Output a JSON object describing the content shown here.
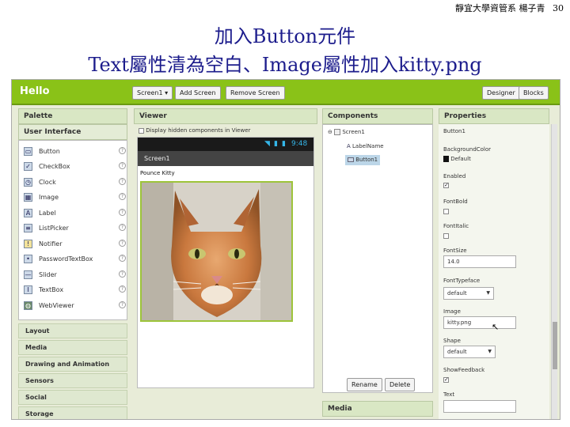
{
  "slide": {
    "header": "靜宜大學資管系 楊子青",
    "page_number": "30",
    "title_line1": "加入Button元件",
    "title_line2": "Text屬性清為空白、Image屬性加入kitty.png"
  },
  "app": {
    "name": "Hello",
    "screen_dropdown": "Screen1 ▾",
    "add_screen": "Add Screen",
    "remove_screen": "Remove Screen",
    "designer": "Designer",
    "blocks": "Blocks"
  },
  "palette": {
    "title": "Palette",
    "section": "User Interface",
    "items": [
      {
        "label": "Button",
        "icon": "▭"
      },
      {
        "label": "CheckBox",
        "icon": "✓"
      },
      {
        "label": "Clock",
        "icon": "◷"
      },
      {
        "label": "Image",
        "icon": "▦"
      },
      {
        "label": "Label",
        "icon": "A"
      },
      {
        "label": "ListPicker",
        "icon": "≡"
      },
      {
        "label": "Notifier",
        "icon": "!"
      },
      {
        "label": "PasswordTextBox",
        "icon": "•"
      },
      {
        "label": "Slider",
        "icon": "—"
      },
      {
        "label": "TextBox",
        "icon": "I"
      },
      {
        "label": "WebViewer",
        "icon": "◍"
      }
    ],
    "categories": [
      "Layout",
      "Media",
      "Drawing and Animation",
      "Sensors",
      "Social",
      "Storage"
    ]
  },
  "viewer": {
    "title": "Viewer",
    "hidden_checkbox_label": "Display hidden components in Viewer",
    "status_time": "9:48",
    "screen_title": "Screen1",
    "label_text": "Pounce Kitty"
  },
  "components": {
    "title": "Components",
    "tree": [
      "Screen1",
      "LabelName",
      "Button1"
    ],
    "rename": "Rename",
    "delete": "Delete",
    "media_title": "Media"
  },
  "properties": {
    "title": "Properties",
    "component": "Button1",
    "background_color_label": "BackgroundColor",
    "background_color_value": "Default",
    "enabled_label": "Enabled",
    "font_bold_label": "FontBold",
    "font_italic_label": "FontItalic",
    "font_size_label": "FontSize",
    "font_size_value": "14.0",
    "font_typeface_label": "FontTypeface",
    "font_typeface_value": "default",
    "image_label": "Image",
    "image_value": "kitty.png",
    "shape_label": "Shape",
    "shape_value": "default",
    "show_feedback_label": "ShowFeedback",
    "text_label": "Text"
  },
  "colors": {
    "title": "#1c1c8c",
    "topbar": "#8ac218",
    "panel_header": "#d9e7c4",
    "background": "#e8ecd8"
  }
}
